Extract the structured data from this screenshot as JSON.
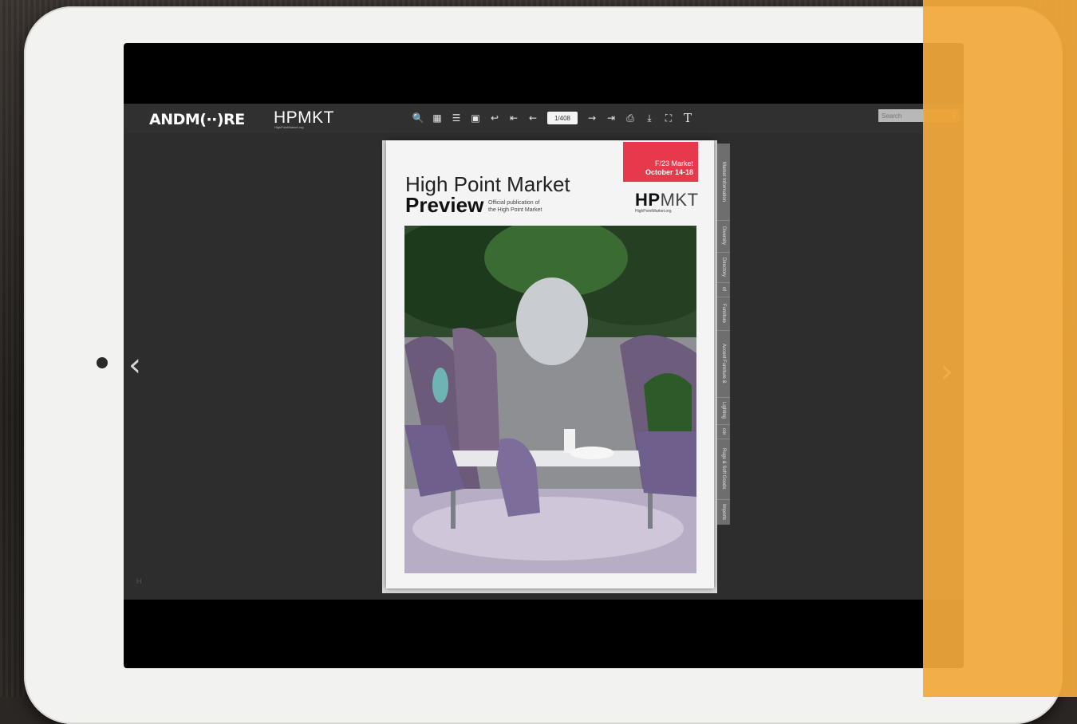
{
  "toolbar": {
    "logo_left": "ANDM(··)RE",
    "logo_right": "HPMKT",
    "logo_right_sub": "HighPointMarket.org",
    "page_indicator": "1/408",
    "search_placeholder": "Search",
    "tools": [
      "zoom-icon",
      "thumbnails-icon",
      "list-icon",
      "single-page-icon",
      "share-icon",
      "first-page-icon",
      "prev-page-icon",
      "next-page-icon",
      "last-page-icon",
      "print-icon",
      "download-icon",
      "fullscreen-icon",
      "text-icon"
    ]
  },
  "magazine": {
    "title_line1": "High Point Market",
    "title_line2": "Preview",
    "subtitle_line1": "Official publication of",
    "subtitle_line2": "the High Point Market",
    "market_line1": "F/23 Market",
    "market_line2": "October 14-18",
    "brand_bold": "HP",
    "brand_thin": "MKT",
    "brand_sub": "HighPointMarket.org"
  },
  "tabs": [
    "Market Information",
    "Diversity",
    "Directory",
    "of",
    "Furniture",
    "Accent Furniture &",
    "Lighting",
    "cor",
    "Rugs & Soft Goods",
    "Imports"
  ],
  "colors": {
    "accent_red": "#e63a4c",
    "overlay_orange": "#f2a93b",
    "viewer_bg": "#2d2d2d"
  }
}
